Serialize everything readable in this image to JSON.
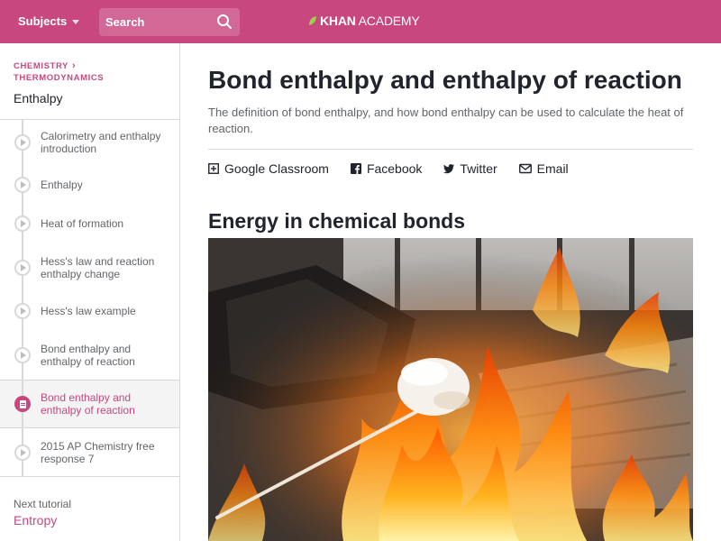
{
  "header": {
    "subjects_label": "Subjects",
    "search_placeholder": "Search",
    "logo_khan": "KHAN",
    "logo_academy": "ACADEMY",
    "brand_color": "#c8477f"
  },
  "sidebar": {
    "breadcrumbs": [
      "CHEMISTRY",
      "THERMODYNAMICS"
    ],
    "title": "Enthalpy",
    "items": [
      {
        "label": "Calorimetry and enthalpy introduction",
        "type": "video",
        "active": false
      },
      {
        "label": "Enthalpy",
        "type": "video",
        "active": false
      },
      {
        "label": "Heat of formation",
        "type": "video",
        "active": false
      },
      {
        "label": "Hess's law and reaction enthalpy change",
        "type": "video",
        "active": false
      },
      {
        "label": "Hess's law example",
        "type": "video",
        "active": false
      },
      {
        "label": "Bond enthalpy and enthalpy of reaction",
        "type": "video",
        "active": false
      },
      {
        "label": "Bond enthalpy and enthalpy of reaction",
        "type": "article",
        "active": true
      },
      {
        "label": "2015 AP Chemistry free response 7",
        "type": "video",
        "active": false
      }
    ],
    "next_label": "Next tutorial",
    "next_link": "Entropy"
  },
  "main": {
    "title": "Bond enthalpy and enthalpy of reaction",
    "description": "The definition of bond enthalpy, and how bond enthalpy can be used to calculate the heat of reaction.",
    "share": [
      {
        "label": "Google Classroom",
        "icon": "google-classroom-icon"
      },
      {
        "label": "Facebook",
        "icon": "facebook-icon"
      },
      {
        "label": "Twitter",
        "icon": "twitter-icon"
      },
      {
        "label": "Email",
        "icon": "email-icon"
      }
    ],
    "section_heading": "Energy in chemical bonds"
  }
}
